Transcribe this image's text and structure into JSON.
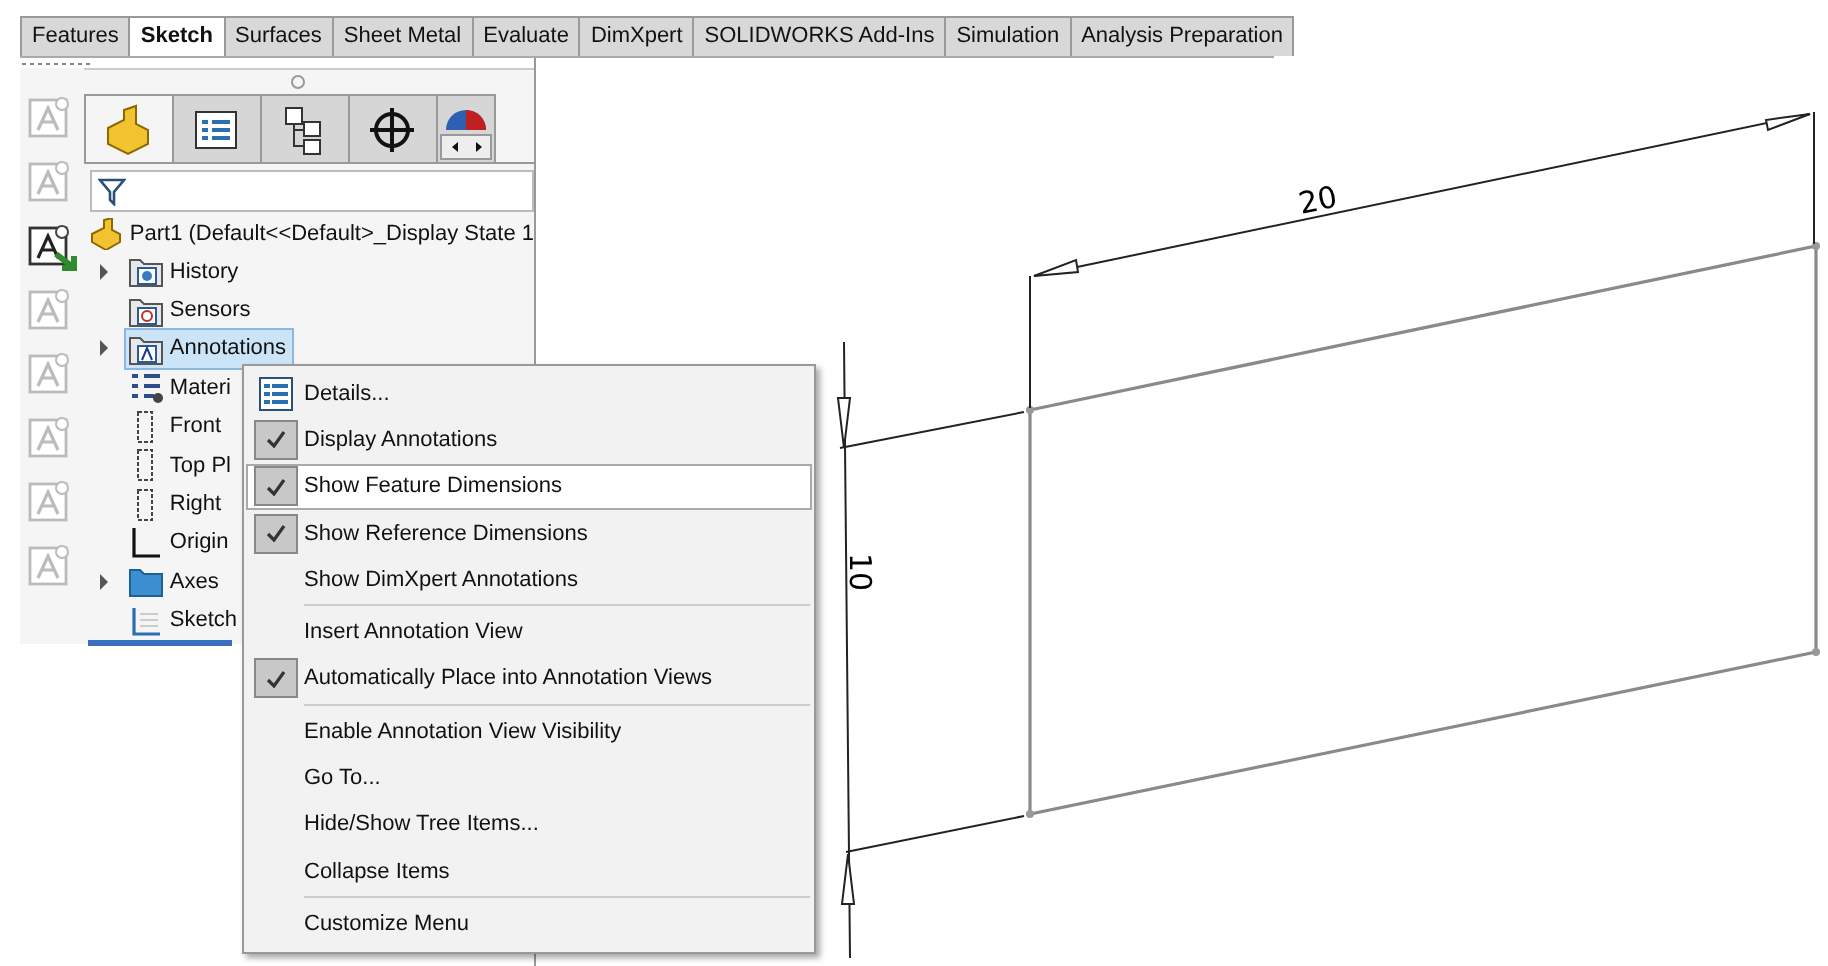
{
  "tabs": [
    {
      "label": "Features",
      "selected": false
    },
    {
      "label": "Sketch",
      "selected": true
    },
    {
      "label": "Surfaces",
      "selected": false
    },
    {
      "label": "Sheet Metal",
      "selected": false
    },
    {
      "label": "Evaluate",
      "selected": false
    },
    {
      "label": "DimXpert",
      "selected": false
    },
    {
      "label": "SOLIDWORKS Add-Ins",
      "selected": false
    },
    {
      "label": "Simulation",
      "selected": false
    },
    {
      "label": "Analysis Preparation",
      "selected": false
    }
  ],
  "annotation_toolbar": [
    {
      "disabled": true
    },
    {
      "disabled": true
    },
    {
      "disabled": false
    },
    {
      "disabled": true
    },
    {
      "disabled": true
    },
    {
      "disabled": true
    },
    {
      "disabled": true
    },
    {
      "disabled": true
    }
  ],
  "panel_tabs": [
    {
      "kind": "part",
      "selected": true
    },
    {
      "kind": "property",
      "selected": false
    },
    {
      "kind": "config",
      "selected": false
    },
    {
      "kind": "crosshair",
      "selected": false
    },
    {
      "kind": "appearance",
      "selected": false
    }
  ],
  "tree": {
    "label": "Part1  (Default<<Default>_Display State 1",
    "children": [
      {
        "label": "History",
        "kind": "history",
        "expandable": true,
        "selected": false
      },
      {
        "label": "Sensors",
        "kind": "sensors",
        "expandable": false,
        "selected": false
      },
      {
        "label": "Annotations",
        "kind": "annotations",
        "expandable": true,
        "selected": true
      },
      {
        "label": "Materi",
        "kind": "material",
        "expandable": false,
        "selected": false
      },
      {
        "label": "Front",
        "kind": "plane",
        "expandable": false,
        "selected": false
      },
      {
        "label": "Top Pl",
        "kind": "plane",
        "expandable": false,
        "selected": false
      },
      {
        "label": "Right",
        "kind": "plane",
        "expandable": false,
        "selected": false
      },
      {
        "label": "Origin",
        "kind": "origin",
        "expandable": false,
        "selected": false
      },
      {
        "label": "Axes",
        "kind": "folder",
        "expandable": true,
        "selected": false
      },
      {
        "label": "Sketch",
        "kind": "sketch",
        "expandable": false,
        "selected": false
      }
    ]
  },
  "context_menu": {
    "groups": [
      [
        {
          "label": "Details...",
          "kind": "icon",
          "checked": false,
          "highlighted": false
        },
        {
          "label": "Display Annotations",
          "kind": "check",
          "checked": true,
          "highlighted": false
        },
        {
          "label": "Show Feature Dimensions",
          "kind": "check",
          "checked": true,
          "highlighted": true
        },
        {
          "label": "Show Reference Dimensions",
          "kind": "check",
          "checked": true,
          "highlighted": false
        },
        {
          "label": "Show DimXpert Annotations",
          "kind": "check",
          "checked": false,
          "highlighted": false
        }
      ],
      [
        {
          "label": "Insert Annotation View",
          "kind": "check",
          "checked": false,
          "highlighted": false
        },
        {
          "label": "Automatically Place into Annotation Views",
          "kind": "check",
          "checked": true,
          "highlighted": false
        }
      ],
      [
        {
          "label": "Enable Annotation View Visibility",
          "kind": "check",
          "checked": false,
          "highlighted": false
        },
        {
          "label": "Go To...",
          "kind": "check",
          "checked": false,
          "highlighted": false
        },
        {
          "label": "Hide/Show Tree Items...",
          "kind": "check",
          "checked": false,
          "highlighted": false
        },
        {
          "label": "Collapse Items",
          "kind": "check",
          "checked": false,
          "highlighted": false
        }
      ],
      [
        {
          "label": "Customize Menu",
          "kind": "check",
          "checked": false,
          "highlighted": false
        }
      ]
    ]
  },
  "sketch": {
    "width_dimension": "20",
    "height_dimension": "10"
  }
}
